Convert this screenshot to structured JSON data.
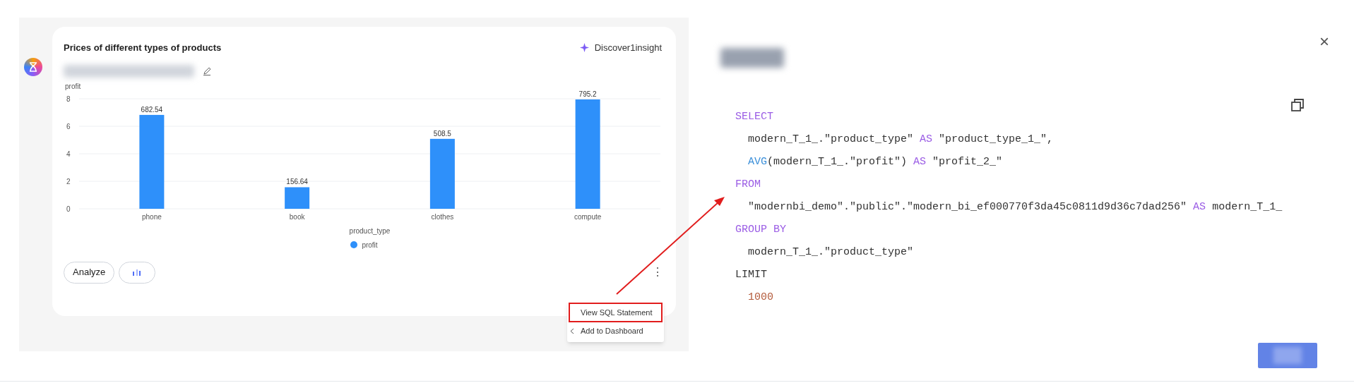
{
  "assistant_card": {
    "title": "Prices of different types of products",
    "insight_button": "Discover1insight",
    "chart_data": {
      "type": "bar",
      "ylabel": "profit",
      "xlabel": "product_type",
      "categories": [
        "phone",
        "book",
        "clothes",
        "compute"
      ],
      "series": [
        {
          "name": "profit",
          "color": "#2e90fa",
          "values": [
            6.8254,
            1.5664,
            5.085,
            7.952
          ]
        }
      ],
      "ylim": [
        0,
        8
      ],
      "yticks": [
        0,
        2,
        4,
        6,
        8
      ],
      "grid": true,
      "value_labels": [
        "682.54",
        "156.64",
        "508.5",
        "795.2"
      ]
    },
    "analyze_button": "Analyze",
    "more_button": "⋮",
    "menu": [
      {
        "label": "View SQL Statement",
        "highlighted": true,
        "submenu": false
      },
      {
        "label": "Add to Dashboard",
        "highlighted": false,
        "submenu": true
      }
    ]
  },
  "sql_panel": {
    "close": "×",
    "lines": [
      {
        "kind": "clause",
        "tokens": [
          {
            "kind": "keyword",
            "text": "SELECT"
          }
        ]
      },
      {
        "kind": "body",
        "tokens": [
          {
            "kind": "plain",
            "text": "modern_T_1_.″product_type″ "
          },
          {
            "kind": "keyword",
            "text": "AS"
          },
          {
            "kind": "plain",
            "text": " ″product_type_1_″,"
          }
        ]
      },
      {
        "kind": "body",
        "tokens": [
          {
            "kind": "function",
            "text": "AVG"
          },
          {
            "kind": "plain",
            "text": "(modern_T_1_.″profit″) "
          },
          {
            "kind": "keyword",
            "text": "AS"
          },
          {
            "kind": "plain",
            "text": " ″profit_2_″"
          }
        ]
      },
      {
        "kind": "clause",
        "tokens": [
          {
            "kind": "keyword",
            "text": "FROM"
          }
        ]
      },
      {
        "kind": "body",
        "tokens": [
          {
            "kind": "plain",
            "text": "″modernbi_demo″.″public″.″modern_bi_ef000770f3da45c0811d9d36c7dad256″ "
          },
          {
            "kind": "keyword",
            "text": "AS"
          },
          {
            "kind": "plain",
            "text": " modern_T_1_"
          }
        ]
      },
      {
        "kind": "clause",
        "tokens": [
          {
            "kind": "keyword",
            "text": "GROUP BY"
          }
        ]
      },
      {
        "kind": "body",
        "tokens": [
          {
            "kind": "plain",
            "text": "modern_T_1_.″product_type″"
          }
        ]
      },
      {
        "kind": "clause",
        "tokens": [
          {
            "kind": "plain",
            "text": "LIMIT"
          }
        ]
      },
      {
        "kind": "body",
        "tokens": [
          {
            "kind": "number",
            "text": "1000"
          }
        ]
      }
    ]
  }
}
